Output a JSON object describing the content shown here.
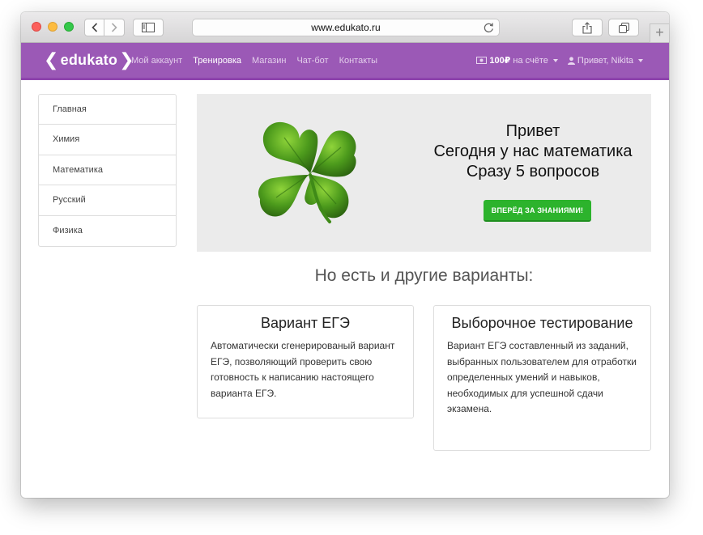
{
  "browser": {
    "url": "www.edukato.ru",
    "icons": {
      "back": "chevron-left-icon",
      "forward": "chevron-right-icon",
      "sidebar": "sidebar-icon",
      "reload": "reload-icon",
      "share": "share-icon",
      "tabs": "tabs-icon",
      "new_tab": "plus-icon"
    },
    "new_tab_glyph": "+"
  },
  "nav": {
    "logo": "edukato",
    "logo_brackets": [
      "❮",
      "❯"
    ],
    "links": [
      "Мой аккаунт",
      "Тренировка",
      "Магазин",
      "Чат-бот",
      "Контакты"
    ],
    "active_link": "Тренировка",
    "balance_amount": "100₽",
    "balance_text": "на счёте",
    "greeting": "Привет, Nikita",
    "colors": {
      "nav_bg": "#9b59b6",
      "nav_border": "#8e44ad",
      "cta": "#2cb32c"
    }
  },
  "sidebar": {
    "items": [
      {
        "label": "Главная"
      },
      {
        "label": "Химия"
      },
      {
        "label": "Математика"
      },
      {
        "label": "Русский"
      },
      {
        "label": "Физика"
      }
    ]
  },
  "hero": {
    "line1": "Привет",
    "line2": "Сегодня у нас математика",
    "line3": "Сразу 5 вопросов",
    "button": "ВПЕРЁД ЗА ЗНАНИЯМИ!",
    "image": "clover-image"
  },
  "options": {
    "title": "Но есть и другие варианты:",
    "cards": [
      {
        "title": "Вариант ЕГЭ",
        "text": "Автоматически сгенерированый вариант ЕГЭ, позволяющий проверить свою готовность к написанию настоящего варианта ЕГЭ."
      },
      {
        "title": "Выборочное тестирование",
        "text": "Вариант ЕГЭ составленный из заданий, выбранных пользователем для отработки определенных умений и навыков, необходимых для успешной сдачи экзамена."
      }
    ]
  }
}
